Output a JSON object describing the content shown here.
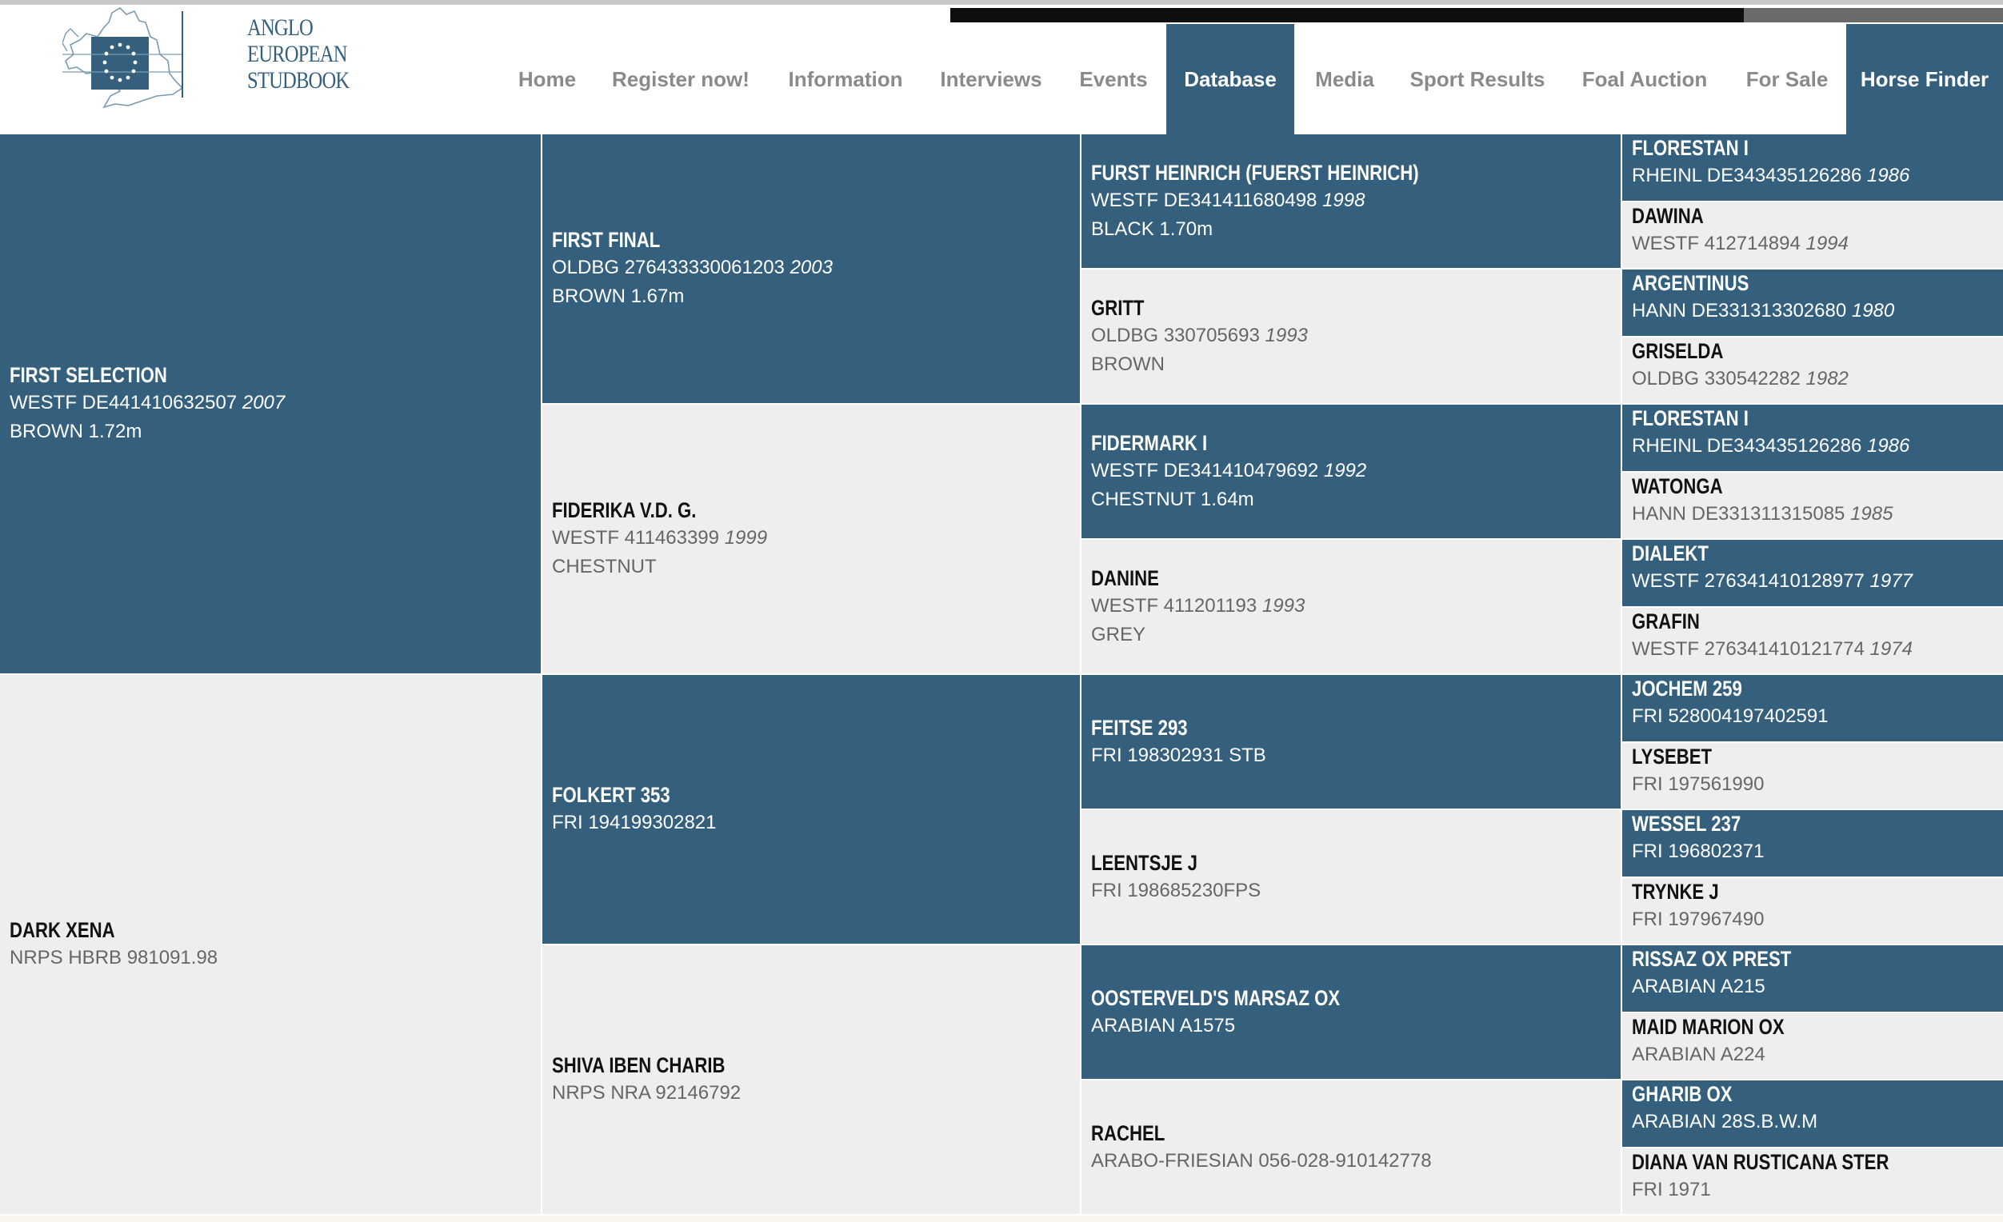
{
  "logo": {
    "lines": [
      "ANGLO",
      "EUROPEAN",
      "STUDBOOK"
    ]
  },
  "nav": {
    "items": [
      {
        "label": "Home"
      },
      {
        "label": "Register now!"
      },
      {
        "label": "Information"
      },
      {
        "label": "Interviews"
      },
      {
        "label": "Events"
      },
      {
        "label": "Database",
        "active": true
      },
      {
        "label": "Media"
      },
      {
        "label": "Sport Results"
      },
      {
        "label": "Foal Auction"
      },
      {
        "label": "For Sale"
      },
      {
        "label": "Horse Finder",
        "active": true
      }
    ]
  },
  "colors": {
    "accent": "#34607e",
    "light_cell": "#eeeeee",
    "nav_text": "#8a8a8a"
  },
  "pedigree": {
    "gen1": [
      {
        "name": "FIRST SELECTION",
        "reg": "WESTF DE441410632507",
        "year": "2007",
        "extra": "BROWN 1.72m",
        "dark": true
      },
      {
        "name": "DARK XENA",
        "reg": "NRPS HBRB 981091.98",
        "year": "",
        "extra": "",
        "dark": false
      }
    ],
    "gen2": [
      {
        "name": "FIRST FINAL",
        "reg": "OLDBG 276433330061203",
        "year": "2003",
        "extra": "BROWN 1.67m",
        "dark": true
      },
      {
        "name": "FIDERIKA V.D. G.",
        "reg": "WESTF 411463399",
        "year": "1999",
        "extra": "CHESTNUT",
        "dark": false
      },
      {
        "name": "FOLKERT 353",
        "reg": "FRI 194199302821",
        "year": "",
        "extra": "",
        "dark": true
      },
      {
        "name": "SHIVA IBEN CHARIB",
        "reg": "NRPS NRA 92146792",
        "year": "",
        "extra": "",
        "dark": false
      }
    ],
    "gen3": [
      {
        "name": "FURST HEINRICH (FUERST HEINRICH)",
        "reg": "WESTF DE341411680498",
        "year": "1998",
        "extra": "BLACK 1.70m",
        "dark": true
      },
      {
        "name": "GRITT",
        "reg": "OLDBG 330705693",
        "year": "1993",
        "extra": "BROWN",
        "dark": false
      },
      {
        "name": "FIDERMARK I",
        "reg": "WESTF DE341410479692",
        "year": "1992",
        "extra": "CHESTNUT 1.64m",
        "dark": true
      },
      {
        "name": "DANINE",
        "reg": "WESTF 411201193",
        "year": "1993",
        "extra": "GREY",
        "dark": false
      },
      {
        "name": "FEITSE 293",
        "reg": "FRI 198302931 STB",
        "year": "",
        "extra": "",
        "dark": true
      },
      {
        "name": "LEENTSJE J",
        "reg": "FRI 198685230FPS",
        "year": "",
        "extra": "",
        "dark": false
      },
      {
        "name": "OOSTERVELD'S MARSAZ OX",
        "reg": "ARABIAN A1575",
        "year": "",
        "extra": "",
        "dark": true
      },
      {
        "name": "RACHEL",
        "reg": "ARABO-FRIESIAN 056-028-910142778",
        "year": "",
        "extra": "",
        "dark": false
      }
    ],
    "gen4": [
      {
        "name": "FLORESTAN I",
        "reg": "RHEINL DE343435126286",
        "year": "1986",
        "dark": true
      },
      {
        "name": "DAWINA",
        "reg": "WESTF 412714894",
        "year": "1994",
        "dark": false
      },
      {
        "name": "ARGENTINUS",
        "reg": "HANN DE331313302680",
        "year": "1980",
        "dark": true
      },
      {
        "name": "GRISELDA",
        "reg": "OLDBG 330542282",
        "year": "1982",
        "dark": false
      },
      {
        "name": "FLORESTAN I",
        "reg": "RHEINL DE343435126286",
        "year": "1986",
        "dark": true
      },
      {
        "name": "WATONGA",
        "reg": "HANN DE331311315085",
        "year": "1985",
        "dark": false
      },
      {
        "name": "DIALEKT",
        "reg": "WESTF 276341410128977",
        "year": "1977",
        "dark": true
      },
      {
        "name": "GRAFIN",
        "reg": "WESTF 276341410121774",
        "year": "1974",
        "dark": false
      },
      {
        "name": "JOCHEM 259",
        "reg": "FRI 528004197402591",
        "year": "",
        "dark": true
      },
      {
        "name": "LYSEBET",
        "reg": "FRI 197561990",
        "year": "",
        "dark": false
      },
      {
        "name": "WESSEL 237",
        "reg": "FRI 196802371",
        "year": "",
        "dark": true
      },
      {
        "name": "TRYNKE J",
        "reg": "FRI 197967490",
        "year": "",
        "dark": false
      },
      {
        "name": "RISSAZ OX PREST",
        "reg": "ARABIAN A215",
        "year": "",
        "dark": true
      },
      {
        "name": "MAID MARION OX",
        "reg": "ARABIAN A224",
        "year": "",
        "dark": false
      },
      {
        "name": "GHARIB OX",
        "reg": "ARABIAN 28S.B.W.M",
        "year": "",
        "dark": true
      },
      {
        "name": "DIANA VAN RUSTICANA STER",
        "reg": "FRI 1971",
        "year": "",
        "dark": false
      }
    ]
  }
}
